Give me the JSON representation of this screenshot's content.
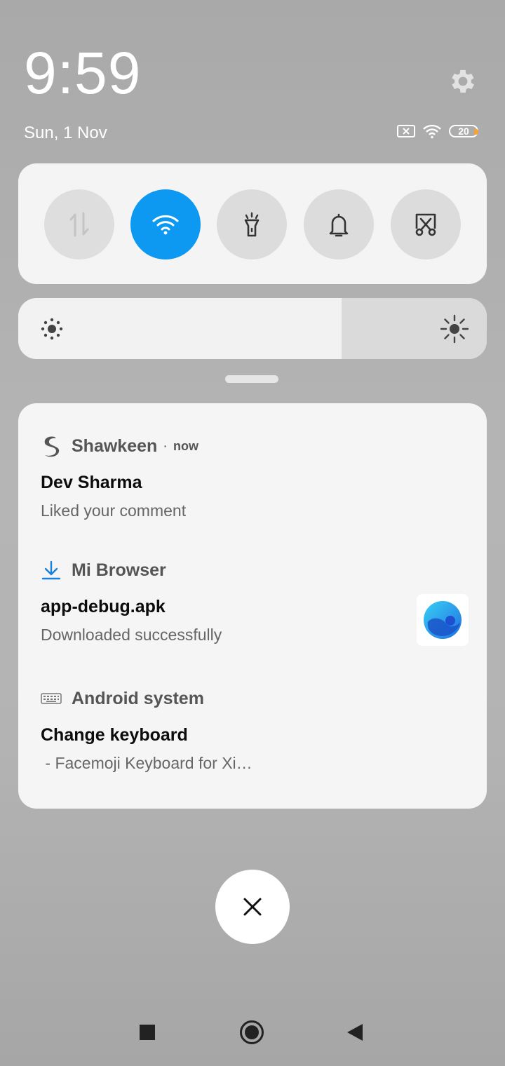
{
  "status": {
    "time": "9:59",
    "date": "Sun, 1 Nov",
    "battery": "20"
  },
  "quick_settings": [
    {
      "name": "mobile-data",
      "active": false
    },
    {
      "name": "wifi",
      "active": true
    },
    {
      "name": "flashlight",
      "active": false
    },
    {
      "name": "sound",
      "active": false
    },
    {
      "name": "screenshot",
      "active": false
    }
  ],
  "brightness": {
    "level_fraction": 0.69
  },
  "notifications": [
    {
      "app": "Shawkeen",
      "time": "now",
      "title": "Dev Sharma",
      "text": "Liked your comment"
    },
    {
      "app": "Mi Browser",
      "title": "app-debug.apk",
      "text": "Downloaded successfully"
    },
    {
      "app": "Android system",
      "title": "Change keyboard",
      "text": " - Facemoji Keyboard for Xi…"
    }
  ],
  "colors": {
    "accent": "#0d99f2",
    "panel": "#f4f4f4"
  }
}
